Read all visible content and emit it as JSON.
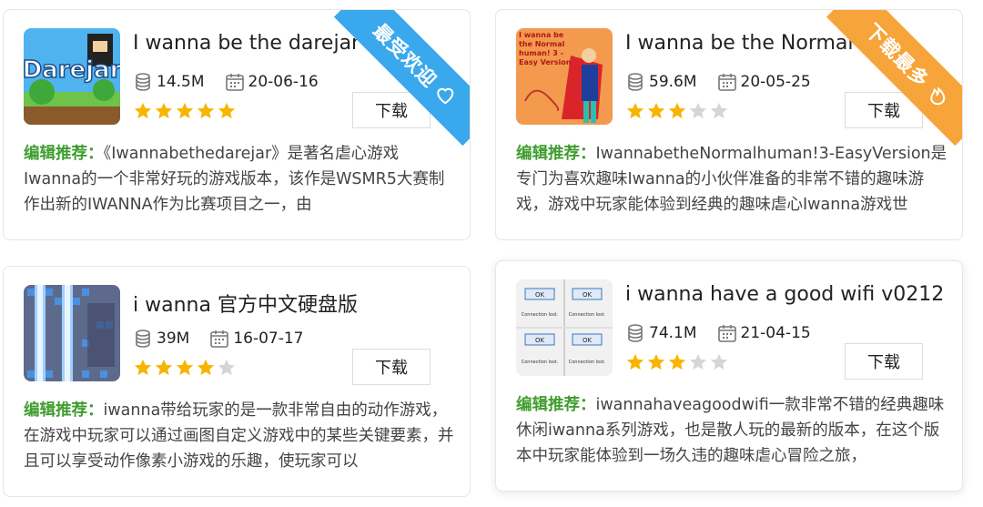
{
  "cards": [
    {
      "title": "I wanna be the darejar",
      "size": "14.5M",
      "date": "20-06-16",
      "rating": 5,
      "download_label": "下载",
      "desc_label": "编辑推荐：",
      "desc_text": "《Iwannabethedarejar》是著名虐心游戏Iwanna的一个非常好玩的游戏版本，该作是WSMR5大赛制作出新的IWANNA作为比赛项目之一，由",
      "ribbon": {
        "text": "最受欢迎",
        "color": "#3aa8ec",
        "icon": "heart-icon"
      },
      "thumb_text": "Darejar"
    },
    {
      "title": "I wanna be the Normal",
      "size": "59.6M",
      "date": "20-05-25",
      "rating": 3,
      "download_label": "下载",
      "desc_label": "编辑推荐：",
      "desc_text": "IwannabetheNormalhuman!3-EasyVersion是专门为喜欢趣味Iwanna的小伙伴准备的非常不错的趣味游戏，游戏中玩家能体验到经典的趣味虐心Iwanna游戏世",
      "ribbon": {
        "text": "下载最多",
        "color": "#f7a43a",
        "icon": "flame-icon"
      },
      "thumb_text": "I wanna be the Normal human! 3 - Easy Version"
    },
    {
      "title": "i wanna 官方中文硬盘版",
      "size": "39M",
      "date": "16-07-17",
      "rating": 4,
      "download_label": "下载",
      "desc_label": "编辑推荐：",
      "desc_text": "iwanna带给玩家的是一款非常自由的动作游戏，在游戏中玩家可以通过画图自定义游戏中的某些关键要素，并且可以享受动作像素小游戏的乐趣，使玩家可以",
      "ribbon": null
    },
    {
      "title": "i wanna have a good wifi v0212",
      "size": "74.1M",
      "date": "21-04-15",
      "rating": 3,
      "download_label": "下载",
      "desc_label": "编辑推荐：",
      "desc_text": "iwannahaveagoodwifi一款非常不错的经典趣味休闲iwanna系列游戏，也是散人玩的最新的版本，在这个版本中玩家能体验到一场久违的趣味虐心冒险之旅，",
      "ribbon": null,
      "thumb_ok": "OK",
      "thumb_lost": "Connection lost."
    }
  ],
  "colors": {
    "star_on": "#f7b500",
    "star_off": "#d5d5d5",
    "label_green": "#3f9d2e"
  }
}
